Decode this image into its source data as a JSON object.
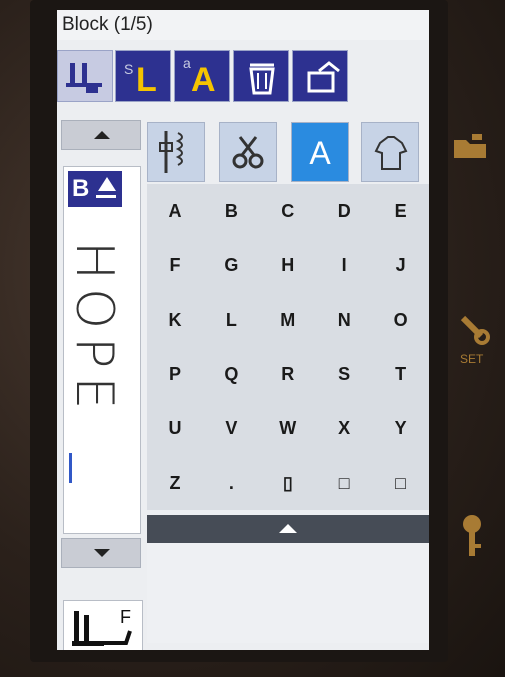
{
  "title": "Block (1/5)",
  "toolbar": [
    {
      "name": "presser-foot-icon"
    },
    {
      "name": "small-letter-size-button",
      "sup": "S",
      "label": "L"
    },
    {
      "name": "font-size-button",
      "sup": "a",
      "label": "A"
    },
    {
      "name": "delete-button"
    },
    {
      "name": "return-button"
    }
  ],
  "sidebar": {
    "badge": "B",
    "preview_text": "HOPE",
    "foot_label": "F"
  },
  "tabs": [
    {
      "name": "utility-stitches-tab",
      "icon": "stitch-icon"
    },
    {
      "name": "decorative-stitches-tab",
      "icon": "scissors-icon"
    },
    {
      "name": "letters-tab",
      "label": "A",
      "active": true
    },
    {
      "name": "applique-tab",
      "icon": "shirt-icon"
    }
  ],
  "keys": [
    [
      "A",
      "B",
      "C",
      "D",
      "E"
    ],
    [
      "F",
      "G",
      "H",
      "I",
      "J"
    ],
    [
      "K",
      "L",
      "M",
      "N",
      "O"
    ],
    [
      "P",
      "Q",
      "R",
      "S",
      "T"
    ],
    [
      "U",
      "V",
      "W",
      "X",
      "Y"
    ],
    [
      "Z",
      ".",
      "▯",
      "□",
      "□"
    ]
  ],
  "right_side": {
    "set_label": "SET"
  },
  "colors": {
    "accent": "#2a8be0",
    "dark_blue": "#2d3190",
    "gold": "#f5c400"
  }
}
